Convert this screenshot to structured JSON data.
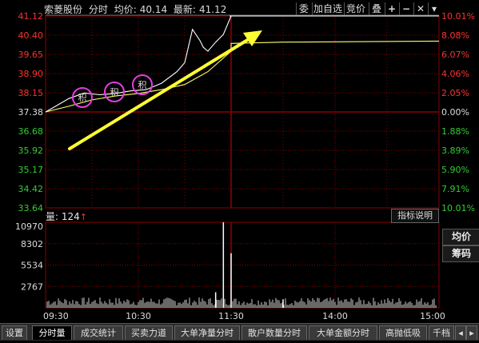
{
  "header": {
    "name": "索菱股份",
    "mode": "分时",
    "avg_label": "均价:",
    "avg_value": "40.14",
    "last_label": "最新:",
    "last_value": "41.12"
  },
  "toolbar": {
    "entrust": "委",
    "add_watch": "加自选",
    "auction": "竞价",
    "overlay": "叠",
    "zoom_in": "+",
    "zoom_out": "−",
    "expand": "▾"
  },
  "price_axis_left": [
    "41.12",
    "40.40",
    "39.65",
    "38.90",
    "38.15",
    "37.38",
    "36.68",
    "35.92",
    "35.17",
    "34.42",
    "33.64"
  ],
  "pct_axis_right": [
    "10.01%",
    "8.08%",
    "6.07%",
    "4.06%",
    "2.05%",
    "0.00%",
    "1.88%",
    "3.89%",
    "5.90%",
    "7.91%",
    "10.01%"
  ],
  "prev_close": "37.38",
  "markers": [
    "积",
    "积",
    "积"
  ],
  "volume_panel": {
    "label": "量",
    "value": "124",
    "indicator_button": "指标说明",
    "axis": [
      "10970",
      "8302",
      "5534",
      "2767"
    ]
  },
  "side_buttons": {
    "avg": "均价",
    "chips": "筹码"
  },
  "time_axis": [
    "09:30",
    "10:30",
    "11:30",
    "14:00",
    "15:00"
  ],
  "tabs": [
    "设置",
    "分时量",
    "成交统计",
    "买卖力道",
    "大单净量分时",
    "散户数量分时",
    "大单金额分时",
    "高抛低吸",
    "千档"
  ],
  "colors": {
    "price_line": "#ffffff",
    "avg_line": "#ffff66",
    "grid": "#8b0000",
    "up_text": "#ff3232",
    "down_text": "#33cc33",
    "arrow": "#ffff33",
    "marker_circle": "#e040e0"
  },
  "chart_data": {
    "type": "line",
    "x_range": [
      "09:30",
      "15:00"
    ],
    "ylim": [
      33.64,
      41.12
    ],
    "prev_close": 37.38,
    "series": [
      {
        "name": "分时",
        "x": [
          "09:30",
          "09:35",
          "09:45",
          "09:55",
          "10:05",
          "10:15",
          "10:25",
          "10:35",
          "10:45",
          "10:55",
          "11:00",
          "11:05",
          "11:10",
          "11:12",
          "11:15",
          "11:20",
          "11:25",
          "11:30",
          "11:30",
          "13:15",
          "13:30",
          "15:00"
        ],
        "values": [
          37.38,
          37.55,
          37.9,
          38.12,
          38.05,
          38.1,
          38.2,
          38.25,
          38.5,
          38.95,
          39.3,
          40.6,
          40.15,
          39.9,
          39.75,
          40.1,
          40.4,
          41.12,
          41.12,
          41.12,
          41.12,
          41.12
        ]
      },
      {
        "name": "均价",
        "x": [
          "09:30",
          "09:45",
          "10:00",
          "10:15",
          "10:30",
          "10:45",
          "11:00",
          "11:15",
          "11:30",
          "13:00",
          "13:30",
          "15:00"
        ],
        "values": [
          37.38,
          37.6,
          37.85,
          38.0,
          38.1,
          38.25,
          38.45,
          38.95,
          39.75,
          40.05,
          40.1,
          40.14
        ]
      }
    ],
    "volume": {
      "ylim": [
        0,
        10970
      ],
      "spikes": [
        {
          "x": "11:25",
          "value": 10970
        },
        {
          "x": "11:30",
          "value": 7000
        },
        {
          "x": "11:20",
          "value": 2000
        },
        {
          "x": "13:30",
          "value": 1100
        }
      ]
    }
  }
}
